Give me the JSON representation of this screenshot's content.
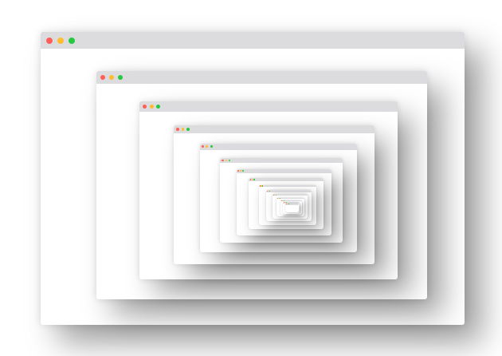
{
  "window": {
    "controls": [
      {
        "name": "close-button-icon",
        "color": "#ff5f57"
      },
      {
        "name": "minimize-button-icon",
        "color": "#febc2e"
      },
      {
        "name": "zoom-button-icon",
        "color": "#28c840"
      }
    ],
    "titlebar_color": "#dcdcdf",
    "content_color": "#ffffff"
  },
  "nesting": {
    "visible_levels": 15
  }
}
